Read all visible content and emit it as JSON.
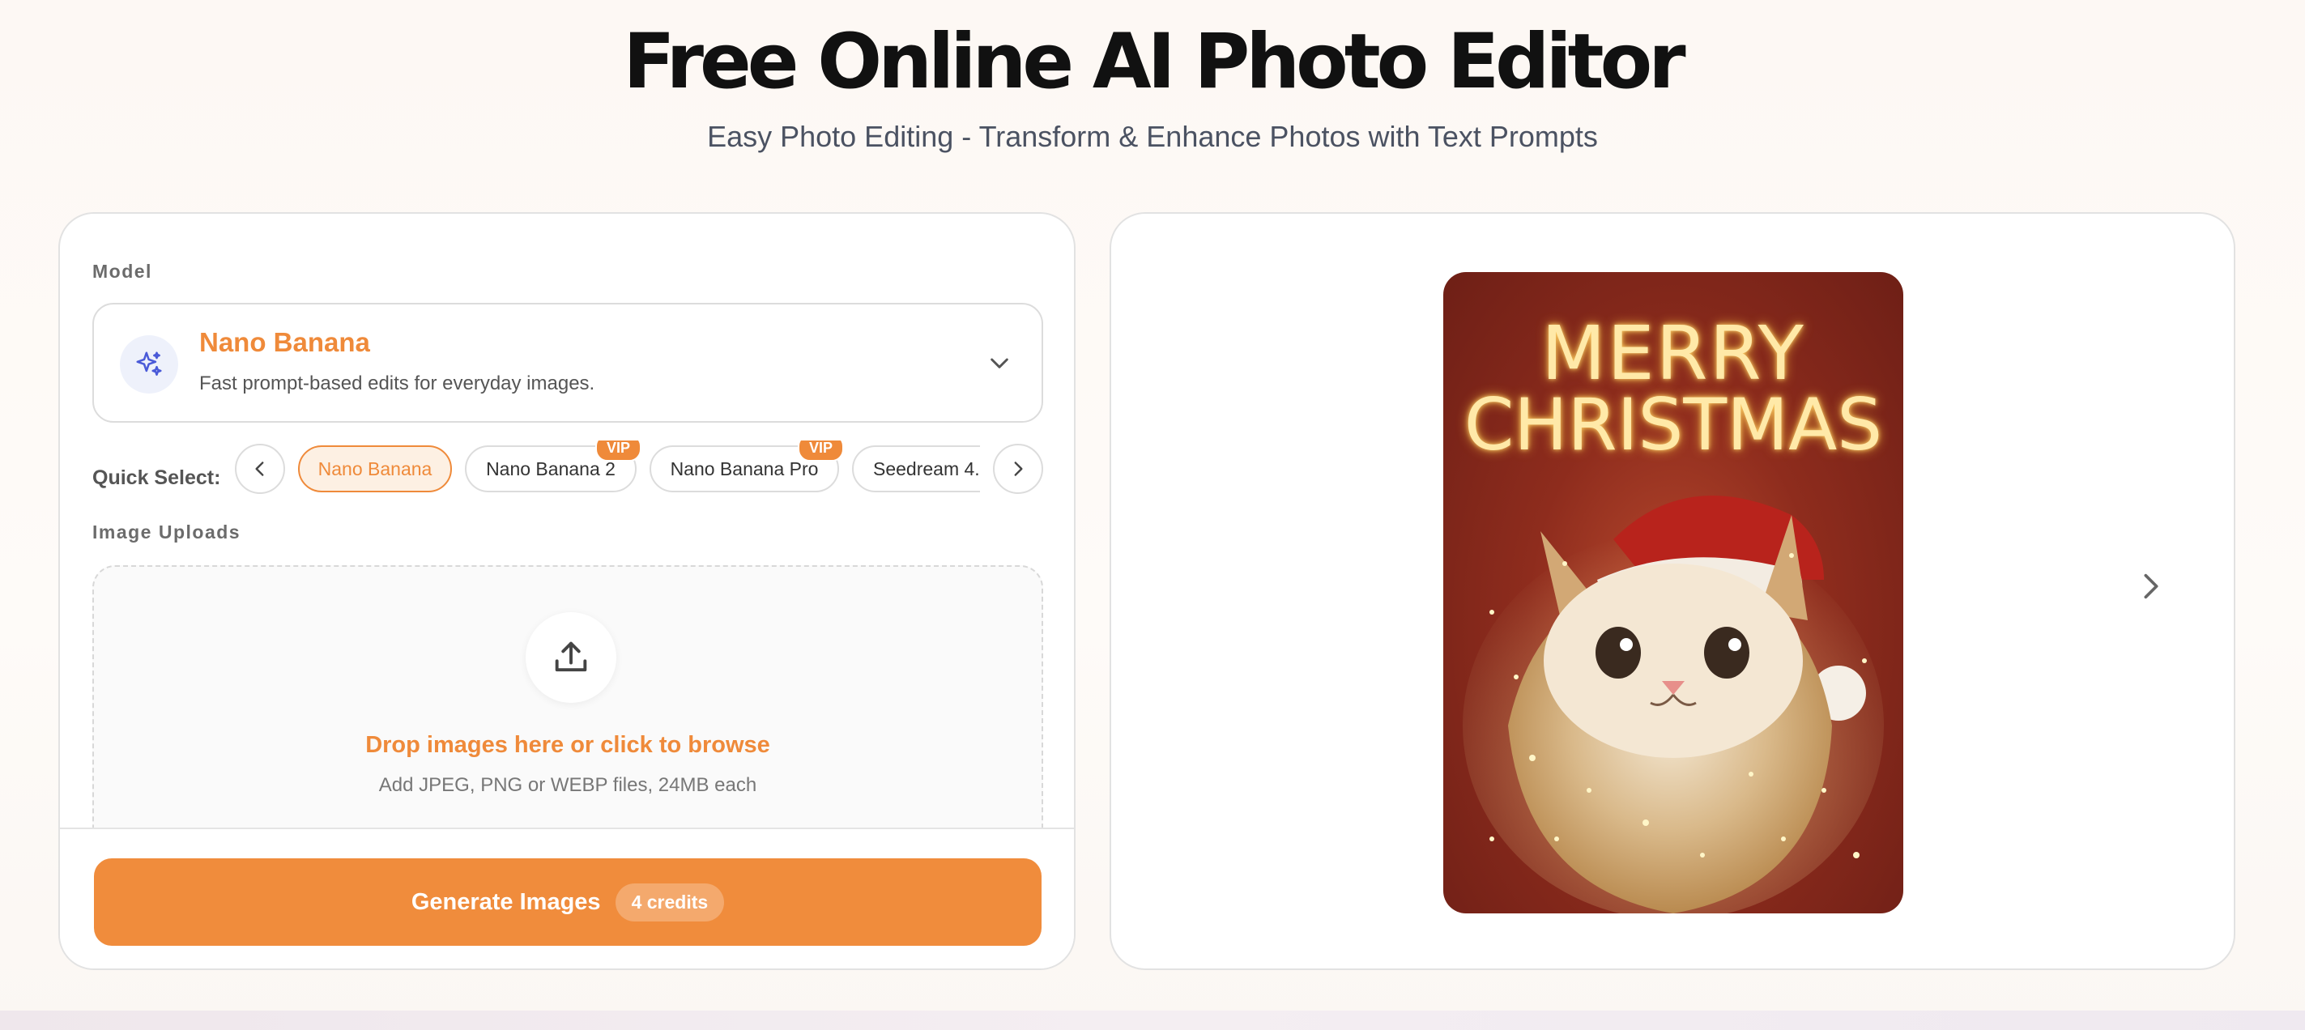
{
  "header": {
    "title": "Free Online AI Photo Editor",
    "subtitle": "Easy Photo Editing - Transform & Enhance Photos with Text Prompts"
  },
  "editor": {
    "model_label": "Model",
    "model": {
      "name": "Nano Banana",
      "description": "Fast prompt-based edits for everyday images.",
      "icon": "sparkles-icon"
    },
    "quick_select": {
      "label": "Quick Select:",
      "chips": [
        {
          "label": "Nano Banana",
          "active": true,
          "badge": ""
        },
        {
          "label": "Nano Banana 2",
          "active": false,
          "badge": "VIP"
        },
        {
          "label": "Nano Banana Pro",
          "active": false,
          "badge": "VIP"
        },
        {
          "label": "Seedream 4.",
          "active": false,
          "badge": ""
        }
      ]
    },
    "uploads_label": "Image Uploads",
    "dropzone": {
      "title": "Drop images here or click to browse",
      "hint": "Add JPEG, PNG or WEBP files, 24MB each",
      "icon": "upload-icon"
    },
    "generate": {
      "label": "Generate Images",
      "credits": "4 credits"
    }
  },
  "preview": {
    "image_text_line1": "MERRY",
    "image_text_line2": "CHRISTMAS",
    "next_icon": "chevron-right-icon"
  },
  "colors": {
    "accent": "#ef8a3a",
    "button": "#f08c3c"
  }
}
